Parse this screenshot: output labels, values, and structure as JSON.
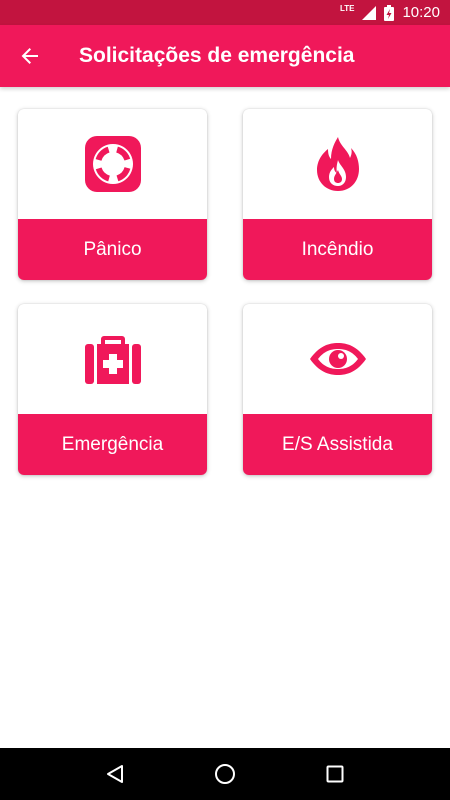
{
  "status_bar": {
    "network": "LTE",
    "time": "10:20"
  },
  "app_bar": {
    "title": "Solicitações de emergência"
  },
  "cards": [
    {
      "label": "Pânico",
      "icon": "lifebuoy-icon"
    },
    {
      "label": "Incêndio",
      "icon": "fire-icon"
    },
    {
      "label": "Emergência",
      "icon": "first-aid-kit-icon"
    },
    {
      "label": "E/S Assistida",
      "icon": "eye-icon"
    }
  ],
  "colors": {
    "primary": "#f0185a",
    "primary_dark": "#c2143f",
    "nav_bar": "#000000"
  }
}
